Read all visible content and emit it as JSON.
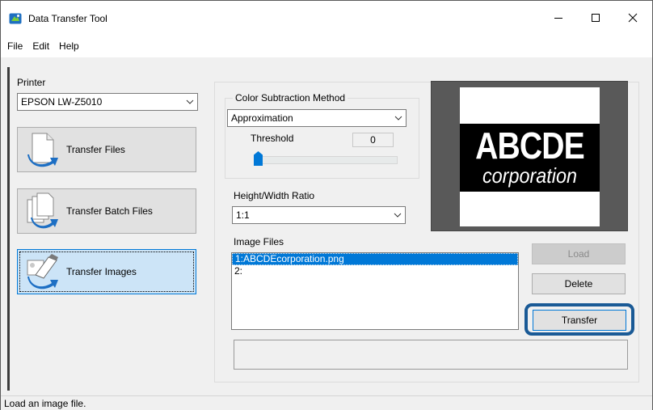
{
  "window": {
    "title": "Data Transfer Tool"
  },
  "menu": {
    "items": [
      "File",
      "Edit",
      "Help"
    ]
  },
  "left_panel": {
    "printer_label": "Printer",
    "printer_value": "EPSON LW-Z5010",
    "buttons": [
      {
        "label": "Transfer Files",
        "icon": "transfer-files-icon",
        "selected": false
      },
      {
        "label": "Transfer Batch Files",
        "icon": "transfer-batch-files-icon",
        "selected": false
      },
      {
        "label": "Transfer Images",
        "icon": "transfer-images-icon",
        "selected": true
      }
    ]
  },
  "right_panel": {
    "color_subtraction": {
      "group_title": "Color Subtraction Method",
      "value": "Approximation",
      "threshold_label": "Threshold",
      "threshold_value": "0"
    },
    "ratio": {
      "label": "Height/Width Ratio",
      "value": "1:1"
    },
    "image_files": {
      "label": "Image Files",
      "items": [
        "1:ABCDEcorporation.png",
        "2:"
      ],
      "selected_index": 0
    },
    "buttons": {
      "load": "Load",
      "delete": "Delete",
      "transfer": "Transfer"
    },
    "preview": {
      "logo_line1": "ABCDE",
      "logo_line2": "corporation"
    }
  },
  "status": {
    "text": "Load an image file."
  },
  "colors": {
    "accent": "#0078d7",
    "highlight_ring": "#1a5a96"
  }
}
